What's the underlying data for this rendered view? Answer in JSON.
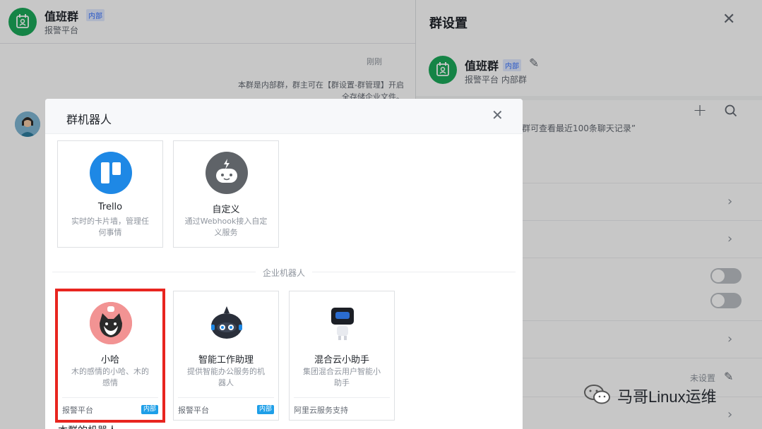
{
  "chat": {
    "title": "值班群",
    "badge": "内部",
    "subtitle": "报警平台",
    "time": "刚刚",
    "notice_line1": "本群是内部群，群主可在【群设置-群管理】开启",
    "notice_line2": "全存储企业文件。"
  },
  "settings": {
    "title": "群设置",
    "close_icon": "close-icon",
    "group_name": "值班群",
    "group_badge": "内部",
    "group_sub": "报警平台  内部群",
    "history_text": "群可查看最近100条聊天记录”",
    "unset_label": "未设置"
  },
  "modal": {
    "title": "群机器人",
    "section_label": "企业机器人",
    "bottom_label": "本群的机器人",
    "bots": [
      {
        "name": "Trello",
        "desc": "实时的卡片墙，管理任何事情",
        "icon": "trello-icon",
        "color": "#1e88e5"
      },
      {
        "name": "自定义",
        "desc": "通过Webhook接入自定义服务",
        "icon": "custom-bot-icon",
        "color": "#5f6368"
      }
    ],
    "enterprise_bots": [
      {
        "name": "小哈",
        "desc": "木的感情的小哈、木的感情",
        "icon": "xiaoha-avatar-icon",
        "foot": "报警平台",
        "badge": "内部"
      },
      {
        "name": "智能工作助理",
        "desc": "提供智能办公服务的机器人",
        "icon": "assistant-bot-icon",
        "foot": "报警平台",
        "badge": "内部"
      },
      {
        "name": "混合云小助手",
        "desc": "集团混合云用户智能小助手",
        "icon": "cloud-helper-icon",
        "foot": "阿里云服务支持",
        "badge": ""
      }
    ]
  },
  "watermark": {
    "text": "马哥Linux运维"
  },
  "colors": {
    "accent": "#3370ff",
    "brand_green": "#1ba95a",
    "selection_red": "#e8251f"
  }
}
